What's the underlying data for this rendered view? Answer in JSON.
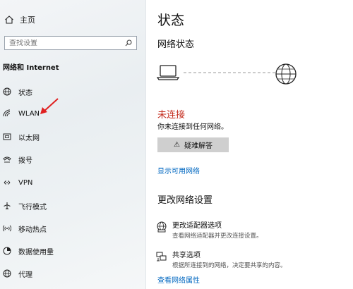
{
  "sidebar": {
    "home_label": "主页",
    "search_placeholder": "查找设置",
    "section_title": "网络和 Internet",
    "items": [
      {
        "label": "状态",
        "icon": "globe-icon"
      },
      {
        "label": "WLAN",
        "icon": "wifi-icon"
      },
      {
        "label": "以太网",
        "icon": "ethernet-icon"
      },
      {
        "label": "拨号",
        "icon": "dialup-icon"
      },
      {
        "label": "VPN",
        "icon": "vpn-icon"
      },
      {
        "label": "飞行模式",
        "icon": "airplane-icon"
      },
      {
        "label": "移动热点",
        "icon": "hotspot-icon"
      },
      {
        "label": "数据使用量",
        "icon": "data-usage-icon"
      },
      {
        "label": "代理",
        "icon": "proxy-globe-icon"
      }
    ]
  },
  "main": {
    "title": "状态",
    "network_status_heading": "网络状态",
    "status_text": "未连接",
    "status_detail": "你未连接到任何网络。",
    "troubleshoot_label": "疑难解答",
    "show_networks_link": "显示可用网络",
    "change_settings_heading": "更改网络设置",
    "settings": [
      {
        "title": "更改适配器选项",
        "desc": "查看网络适配器并更改连接设置。",
        "icon": "adapter-icon"
      },
      {
        "title": "共享选项",
        "desc": "根据所连接到的网络，决定要共享的内容。",
        "icon": "sharing-icon"
      }
    ],
    "properties_link": "查看网络属性"
  },
  "colors": {
    "accent": "#0067c0",
    "error": "#c42b1c",
    "annotation_arrow": "#e02020"
  }
}
